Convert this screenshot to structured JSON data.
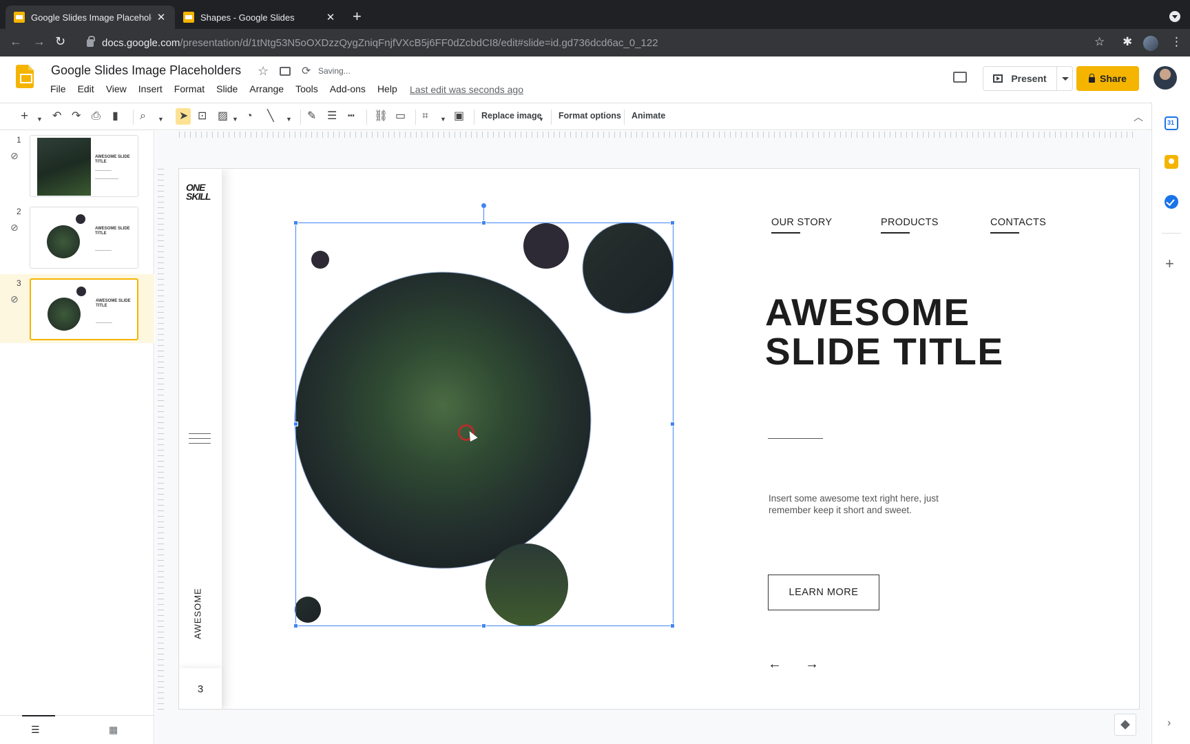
{
  "browser": {
    "tabs": [
      {
        "title": "Google Slides Image Placeholo",
        "active": true
      },
      {
        "title": "Shapes - Google Slides",
        "active": false
      }
    ],
    "url_host": "docs.google.com",
    "url_path": "/presentation/d/1tNtg53N5oOXDzzQygZniqFnjfVXcB5j6FF0dZcbdCI8/edit#slide=id.gd736dcd6ac_0_122"
  },
  "app": {
    "doc_title": "Google Slides Image Placeholders",
    "saving_status": "Saving...",
    "menus": [
      "File",
      "Edit",
      "View",
      "Insert",
      "Format",
      "Slide",
      "Arrange",
      "Tools",
      "Add-ons",
      "Help"
    ],
    "last_edit": "Last edit was seconds ago",
    "present_label": "Present",
    "share_label": "Share"
  },
  "toolbar": {
    "replace_image": "Replace image",
    "format_options": "Format options",
    "animate": "Animate"
  },
  "filmstrip": {
    "slides": [
      {
        "number": "1",
        "selected": false,
        "title": "AWESOME SLIDE TITLE"
      },
      {
        "number": "2",
        "selected": false,
        "title": "AWESOME SLIDE TITLE"
      },
      {
        "number": "3",
        "selected": true,
        "title": "AWESOME SLIDE TITLE"
      }
    ]
  },
  "slide": {
    "brand_logo_line1": "ONE",
    "brand_logo_line2": "SKILL",
    "vertical_label": "AWESOME",
    "page_number": "3",
    "nav_links": [
      "OUR STORY",
      "PRODUCTS",
      "CONTACTS"
    ],
    "title_line1": "AWESOME",
    "title_line2": "SLIDE TITLE",
    "body_text": "Insert some awesome text right here, just remember keep it short and sweet.",
    "cta_label": "LEARN MORE",
    "arrow_left": "←",
    "arrow_right": "→"
  },
  "colors": {
    "accent_yellow": "#f4b400",
    "selection_blue": "#4285f4",
    "dark_circle": "#2e2a35"
  }
}
